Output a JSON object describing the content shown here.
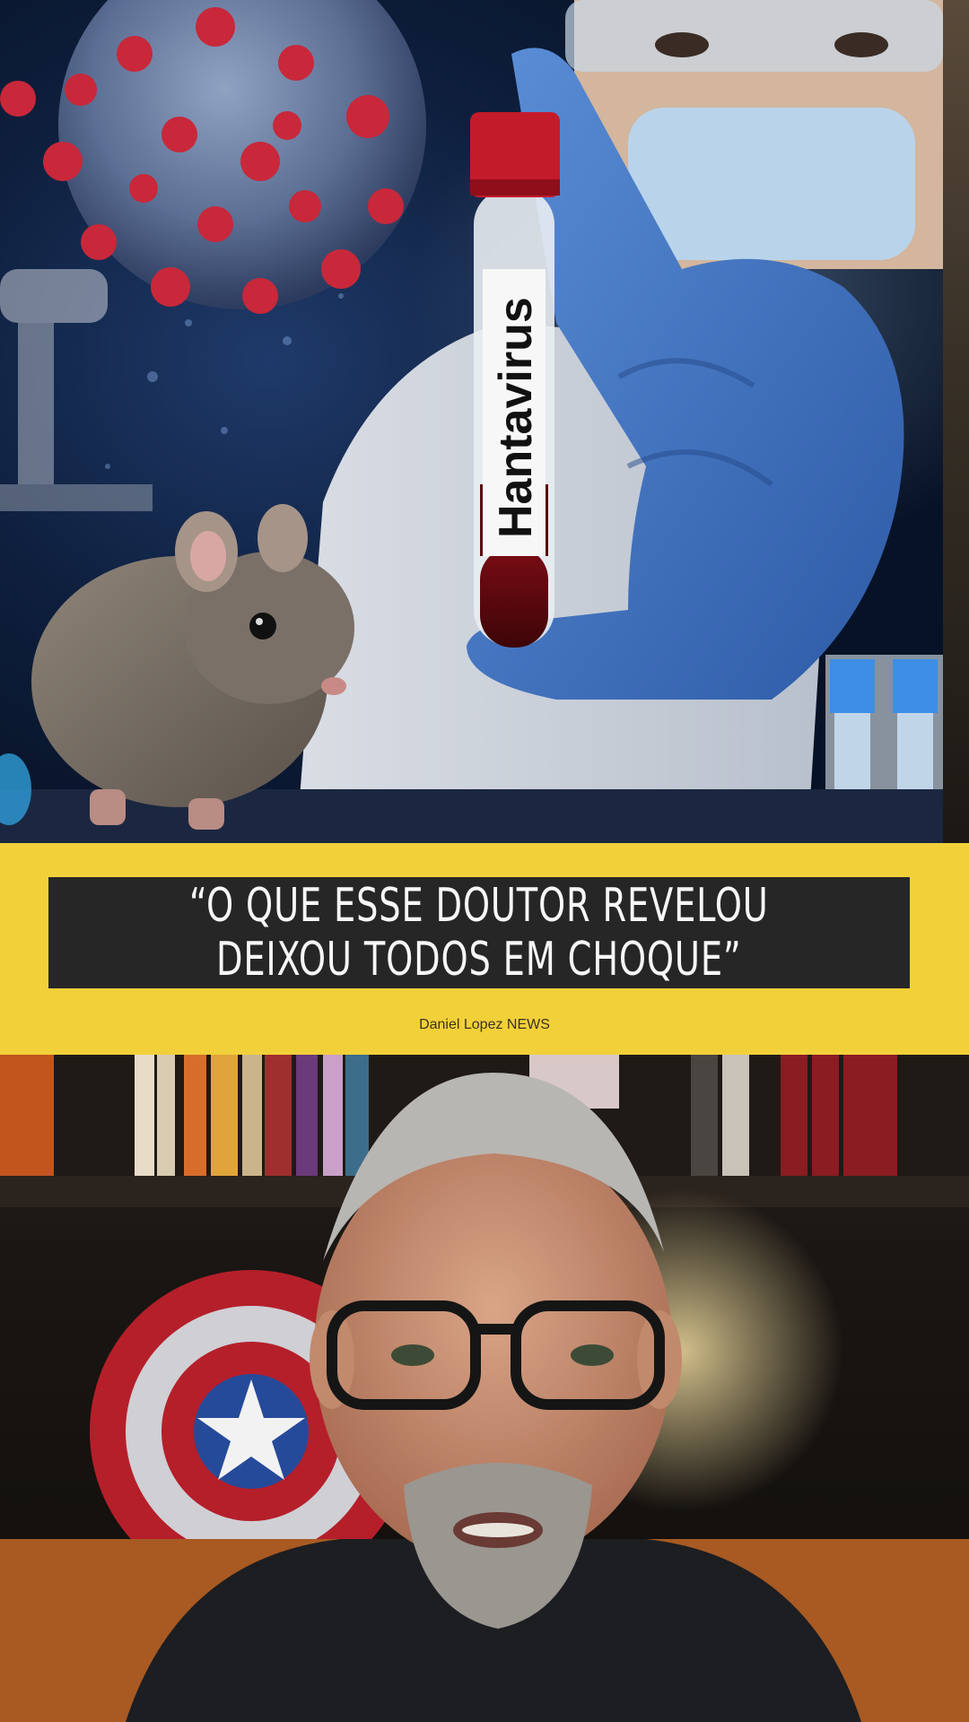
{
  "banner": {
    "headline": "“O QUE ESSE DOUTOR REVELOU\nDEIXOU TODOS EM CHOQUE”",
    "credit": "Daniel Lopez NEWS"
  },
  "top_image": {
    "tube_label": "Hantavirus"
  },
  "colors": {
    "banner_bg": "#f2d03a",
    "headline_box": "#262626",
    "headline_text": "#f7f7f7"
  }
}
